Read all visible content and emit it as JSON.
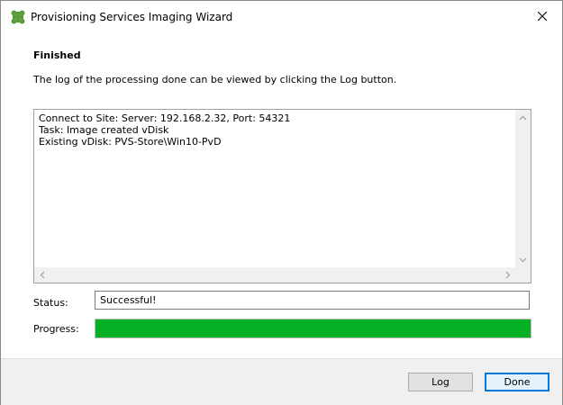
{
  "window": {
    "title": "Provisioning Services Imaging Wizard"
  },
  "page": {
    "heading": "Finished",
    "description": "The log of the processing done can be viewed by clicking the Log button."
  },
  "log": {
    "lines": [
      "Connect to Site: Server: 192.168.2.32, Port: 54321",
      "Task: Image created vDisk",
      "Existing vDisk: PVS-Store\\Win10-PvD"
    ]
  },
  "status": {
    "label": "Status:",
    "value": "Successful!"
  },
  "progress": {
    "label": "Progress:",
    "percent": 100,
    "color": "#06b025"
  },
  "buttons": {
    "log": "Log",
    "done": "Done"
  },
  "colors": {
    "accent": "#0078d7",
    "progress": "#06b025",
    "logo": "#5a9e3a"
  },
  "icons": {
    "app": "citrix-logo-icon",
    "close": "close-icon"
  }
}
